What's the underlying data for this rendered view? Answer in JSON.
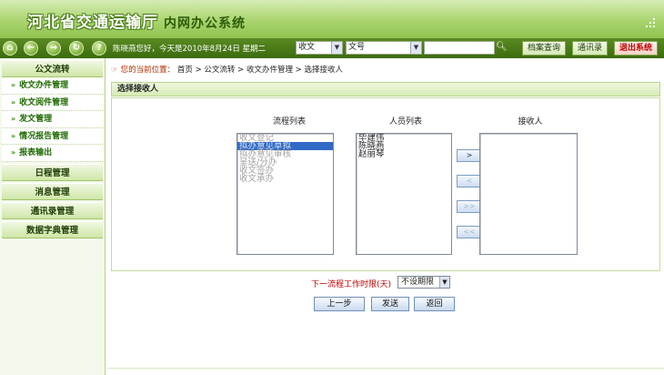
{
  "app": {
    "title": "河北省交通运输厅",
    "subtitle": "内网办公系统"
  },
  "toolbar": {
    "greeting": "陈晓燕您好，今天是2010年8月24日 星期二",
    "doc_type_select": "收文",
    "doc_field_select": "文号",
    "search_value": "",
    "archive_query": "档案查询",
    "address_book": "通讯录",
    "exit": "退出系统",
    "icons": [
      "home-icon",
      "back-icon",
      "forward-icon",
      "refresh-icon",
      "help-icon"
    ]
  },
  "sidebar": {
    "sections": [
      {
        "title": "公文流转",
        "items": [
          "收文办件管理",
          "收文阅件管理",
          "发文管理",
          "情况报告管理",
          "报表输出"
        ]
      },
      {
        "title": "日程管理",
        "items": []
      },
      {
        "title": "消息管理",
        "items": []
      },
      {
        "title": "通讯录管理",
        "items": []
      },
      {
        "title": "数据字典管理",
        "items": []
      }
    ]
  },
  "breadcrumb": {
    "label": "您的当前位置：",
    "path": [
      "首页",
      "公文流转",
      "收文办件管理",
      "选择接收人"
    ]
  },
  "section_title": "选择接收人",
  "selector": {
    "flow_title": "流程列表",
    "people_title": "人员列表",
    "receiver_title": "接收人",
    "flow_items": [
      "收文登记",
      "拟办意见草拟",
      "拟办意见审核",
      "呈送/分办",
      "收文签办",
      "收文承办"
    ],
    "flow_selected_index": 1,
    "people_items": [
      "毕建伟",
      "陈晓燕",
      "赵丽琴"
    ],
    "receivers": [],
    "buttons": [
      ">",
      "<",
      ">>",
      "<<"
    ]
  },
  "deadline": {
    "label": "下一流程工作时限(天)",
    "value": "不设期限"
  },
  "actions": {
    "prev": "上一步",
    "send": "发送",
    "back": "返回"
  },
  "colors": {
    "header_green": "#8fc250",
    "toolbar_green": "#3c6b0e",
    "exit_red": "#c00000",
    "selection_blue": "#316ac5"
  }
}
